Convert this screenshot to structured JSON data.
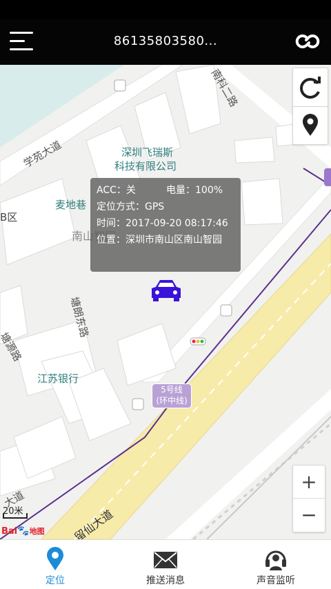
{
  "header": {
    "title": "86135803580..."
  },
  "map": {
    "labels": {
      "road_xueyuan": "学苑大道",
      "road_nanke": "南科二路",
      "company": "深圳飞瑞斯\n科技有限公司",
      "company_line1": "深圳飞瑞斯",
      "company_line2": "科技有限公司",
      "maidi": "麦地巷",
      "b_district": "B区",
      "nanshan": "南山智园",
      "tangming": "塘朗东路",
      "bank": "江苏银行",
      "yuan_road": "塘源路",
      "road_liuxian_left": "大道",
      "road_liuxian": "留仙大道",
      "metro_line": "5号线",
      "metro_loop": "(环中线)"
    },
    "scale": "20米",
    "logo_text": "Bai",
    "logo_map": "地图"
  },
  "info_window": {
    "acc": "ACC：关",
    "battery": "电量：100%",
    "locate_mode": "定位方式：GPS",
    "time": "时间：2017-09-20 08:17:46",
    "position": "位置：深圳市南山区南山智园"
  },
  "controls": {
    "zoom_in": "+",
    "zoom_out": "−"
  },
  "tabs": [
    {
      "label": "定位",
      "icon": "location-pin-icon",
      "active": true
    },
    {
      "label": "推送消息",
      "icon": "envelope-icon",
      "active": false
    },
    {
      "label": "声音监听",
      "icon": "headset-icon",
      "active": false
    }
  ],
  "colors": {
    "accent": "#1c8bd8",
    "car": "#3a12d9",
    "metro_line": "#5b2f8c",
    "main_road": "#f6e9a6"
  }
}
